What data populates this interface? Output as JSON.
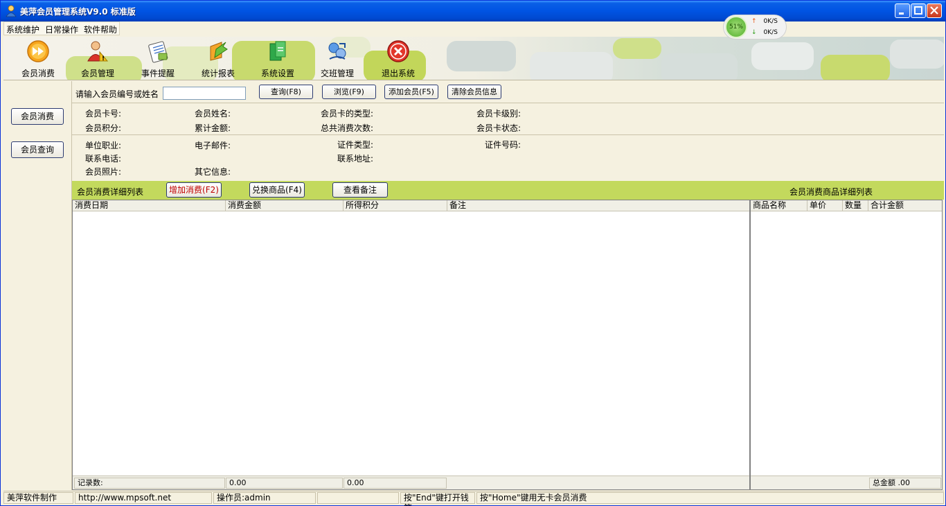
{
  "window": {
    "title": "美萍会员管理系统V9.0 标准版"
  },
  "network_widget": {
    "percent": "51%",
    "upload": "0K/S",
    "download": "0K/S"
  },
  "menu": [
    "系统维护",
    "日常操作",
    "软件帮助"
  ],
  "toolbar": [
    {
      "label": "会员消费",
      "icon": "fast-forward-icon"
    },
    {
      "label": "会员管理",
      "icon": "members-icon"
    },
    {
      "label": "事件提醒",
      "icon": "notepad-icon"
    },
    {
      "label": "统计报表",
      "icon": "report-icon"
    },
    {
      "label": "系统设置",
      "icon": "settings-icon"
    },
    {
      "label": "交班管理",
      "icon": "shift-icon"
    },
    {
      "label": "退出系统",
      "icon": "exit-icon"
    }
  ],
  "leftnav": [
    "会员消费",
    "会员查询"
  ],
  "search": {
    "label": "请输入会员编号或姓名",
    "value": "",
    "buttons": [
      "查询(F8)",
      "浏览(F9)",
      "添加会员(F5)",
      "清除会员信息"
    ]
  },
  "info_fields_1": [
    "会员卡号:",
    "会员姓名:",
    "会员卡的类型:",
    "会员卡级别:",
    "会员积分:",
    "累计金额:",
    "总共消费次数:",
    "会员卡状态:"
  ],
  "info_fields_2": [
    "单位职业:",
    "电子邮件:",
    "证件类型:",
    "证件号码:",
    "联系电话:",
    "联系地址:",
    "会员照片:",
    "其它信息:"
  ],
  "consume_bar": {
    "title": "会员消费详细列表",
    "add_button": "增加消费(F2)",
    "exchange_button": "兑换商品(F4)",
    "note_button": "查看备注",
    "goods_title": "会员消费商品详细列表"
  },
  "consume_table": {
    "columns": [
      "消费日期",
      "消费金额",
      "所得积分",
      "备注"
    ],
    "footer": [
      "记录数:",
      "0.00",
      "0.00"
    ]
  },
  "goods_table": {
    "columns": [
      "商品名称",
      "单价",
      "数量",
      "合计金额"
    ],
    "footer_total": "总金额 .00"
  },
  "statusbar": [
    "美萍软件制作",
    "http://www.mpsoft.net",
    "操作员:admin",
    "",
    "按\"End\"键打开钱箱",
    "按\"Home\"键用无卡会员消费"
  ],
  "colors": {
    "accent_green": "#c3d95d",
    "title_blue": "#0054e3",
    "add_button_text": "#c00000"
  }
}
